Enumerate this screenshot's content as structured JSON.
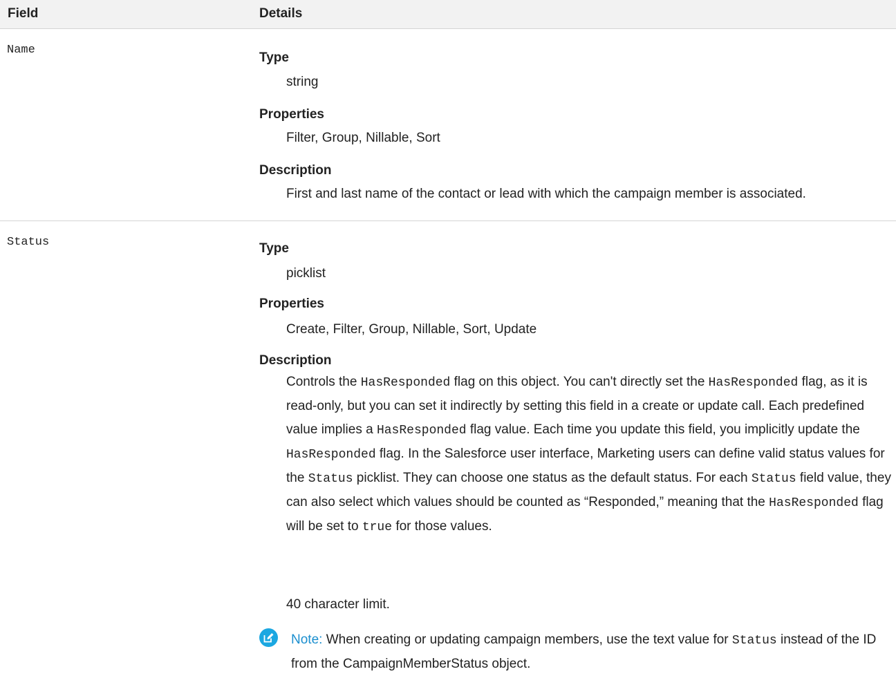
{
  "header": {
    "field": "Field",
    "details": "Details"
  },
  "rows": [
    {
      "field": "Name",
      "type_label": "Type",
      "type": "string",
      "properties_label": "Properties",
      "properties": "Filter, Group, Nillable, Sort",
      "description_label": "Description",
      "description": "First and last name of the contact or lead with which the campaign member is associated."
    },
    {
      "field": "Status",
      "type_label": "Type",
      "type": "picklist",
      "properties_label": "Properties",
      "properties": "Create, Filter, Group, Nillable, Sort, Update",
      "description_label": "Description",
      "desc": {
        "p1": "Controls the ",
        "c1": "HasResponded",
        "p2": " flag on this object. You can't directly set the ",
        "c2": "HasResponded",
        "p3": " flag, as it is read-only, but you can set it indirectly by setting this field in a create or update call. Each predefined value implies a ",
        "c3": "HasResponded",
        "p4": " flag value. Each time you update this field, you implicitly update the ",
        "c4": "HasResponded",
        "p5": " flag. In the Salesforce user interface, Marketing users can define valid status values for the ",
        "c5": "Status",
        "p6": " picklist. They can choose one status as the default status. For each ",
        "c6": "Status",
        "p7": " field value, they can also select which values should be counted as “Responded,” meaning that the ",
        "c7": "HasResponded",
        "p8": " flag will be set to ",
        "c8": "true",
        "p9": " for those values."
      },
      "limit": "40 character limit.",
      "note": {
        "icon": "edit-note-icon",
        "label": "Note:",
        "t1": " When creating or updating campaign members, use the text value for ",
        "c1": "Status",
        "t2": " instead of the ID from the CampaignMemberStatus object."
      }
    }
  ],
  "colors": {
    "note_icon": "#1ba7e1",
    "note_label": "#1b8fcf",
    "header_bg": "#f2f2f2"
  }
}
